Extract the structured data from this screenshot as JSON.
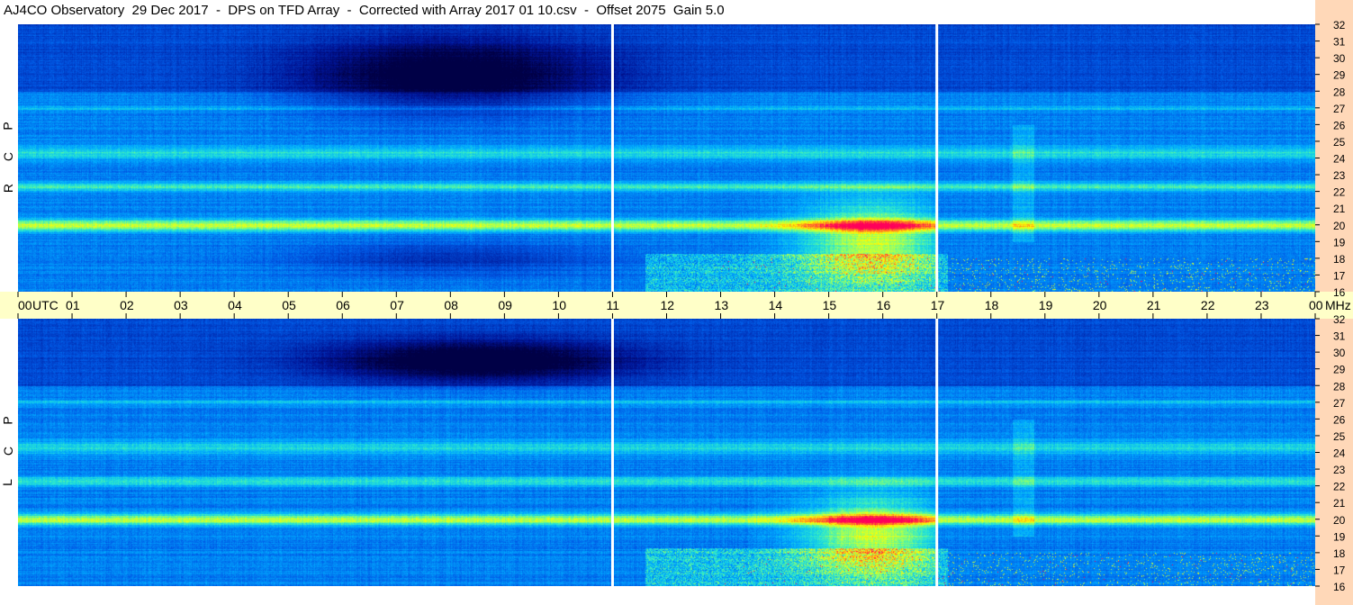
{
  "title": "AJ4CO Observatory  29 Dec 2017  -  DPS on TFD Array  -  Corrected with Array 2017 01 10.csv  -  Offset 2075  Gain 5.0",
  "panels": [
    {
      "name": "rcp",
      "label": [
        "R",
        "C",
        "P"
      ]
    },
    {
      "name": "lcp",
      "label": [
        "L",
        "C",
        "P"
      ]
    }
  ],
  "chart_data": {
    "type": "heatmap",
    "title": "AJ4CO Observatory  29 Dec 2017  -  DPS on TFD Array  -  Corrected with Array 2017 01 10.csv  -  Offset 2075  Gain 5.0",
    "xlabel": "UTC",
    "ylabel": "MHz",
    "x_ticks": [
      "00",
      "01",
      "02",
      "03",
      "04",
      "05",
      "06",
      "07",
      "08",
      "09",
      "10",
      "11",
      "12",
      "13",
      "14",
      "15",
      "16",
      "17",
      "18",
      "19",
      "20",
      "21",
      "22",
      "23",
      "00"
    ],
    "xlim": [
      0,
      24
    ],
    "y_ticks": [
      32,
      31,
      30,
      29,
      28,
      27,
      26,
      25,
      24,
      23,
      22,
      21,
      20,
      19,
      18,
      17,
      16
    ],
    "ylim": [
      16,
      32
    ],
    "series": [
      {
        "name": "R C P"
      },
      {
        "name": "L C P"
      }
    ],
    "gaps_utc": [
      11,
      17
    ],
    "colors": {
      "low": "#00008b",
      "mid": "#00a0ff",
      "high": "#ffff00",
      "peak": "#ff0000"
    }
  }
}
